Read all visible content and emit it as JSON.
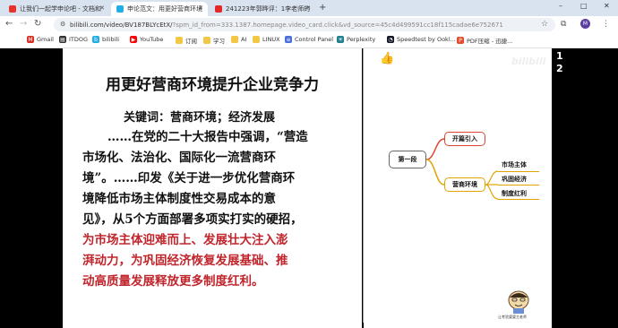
{
  "browser": {
    "tabs": [
      {
        "label": "让我们一起学申论吧 - 文档和",
        "favicon_color": "#e8332a",
        "active": false
      },
      {
        "label": "申论范文：用更好营商环境",
        "favicon_color": "#23ade5",
        "active": true
      },
      {
        "label": "241223年郭晔评：1李老师的",
        "favicon_color": "#e5282a",
        "active": false
      }
    ],
    "new_tab": "+",
    "window_controls": [
      "–",
      "□",
      "✕"
    ],
    "url_main": "bilibili.com/video/BV187BLYcEtX/",
    "url_rest": "?spm_id_from=333.1387.homepage.video_card.click&vd_source=45c4d499591cc18f115cadae6e752671",
    "avatar_letter": "M",
    "bookmarks": [
      {
        "label": "Gmail",
        "icon": "gmail-icon",
        "color": "#d93025",
        "glyph": "M"
      },
      {
        "label": "ITDOG",
        "icon": "itdog-icon",
        "color": "#333333",
        "glyph": "▤"
      },
      {
        "label": "bilibili",
        "icon": "bilibili-icon",
        "color": "#23ade5",
        "glyph": "b"
      },
      {
        "label": "YouTube",
        "icon": "youtube-icon",
        "color": "#ff0000",
        "glyph": "▶"
      },
      {
        "label": "订阅",
        "icon": "folder-icon",
        "color": "#f2c744",
        "glyph": ""
      },
      {
        "label": "学习",
        "icon": "folder-icon",
        "color": "#f2c744",
        "glyph": ""
      },
      {
        "label": "AI",
        "icon": "folder-icon",
        "color": "#f2c744",
        "glyph": ""
      },
      {
        "label": "LINUX",
        "icon": "folder-icon",
        "color": "#f2c744",
        "glyph": ""
      },
      {
        "label": "Control Panel",
        "icon": "control-panel-icon",
        "color": "#4a6fd8",
        "glyph": "≡"
      },
      {
        "label": "Perplexity",
        "icon": "perplexity-icon",
        "color": "#20808d",
        "glyph": "✳"
      },
      {
        "label": "Speedtest by Ookl...",
        "icon": "speedtest-icon",
        "color": "#141526",
        "glyph": "◔"
      },
      {
        "label": "PDF压缩 - 迅捷...",
        "icon": "pdf-icon",
        "color": "#e84a2f",
        "glyph": "P"
      }
    ]
  },
  "slide": {
    "title": "用更好营商环境提升企业竞争力",
    "keywords": "关键词：营商环境；经济发展",
    "body_lines": [
      {
        "text": "……在党的二十大报告中强调，“营造",
        "red": false,
        "indent": true
      },
      {
        "text": "市场化、法治化、国际化一流营商环",
        "red": false,
        "indent": false
      },
      {
        "text": "境”。……印发《关于进一步优化营商环",
        "red": false,
        "indent": false
      },
      {
        "text": "境降低市场主体制度性交易成本的意",
        "red": false,
        "indent": false
      },
      {
        "text": "见》，从5个方面部署多项实打实的硬招，",
        "red": false,
        "indent": false
      },
      {
        "text": "为市场主体迎难而上、发展壮大注入澎",
        "red": true,
        "indent": false
      },
      {
        "text": "湃动力，为巩固经济恢复发展基础、推",
        "red": true,
        "indent": false
      },
      {
        "text": "动高质量发展释放更多制度红利。",
        "red": true,
        "indent": false
      }
    ]
  },
  "mindmap": {
    "root": "第一段",
    "branch_a": "开篇引入",
    "branch_b": "营商环境",
    "leaves": [
      "市场主体",
      "巩固经济",
      "制度红利"
    ],
    "watermark": "bilibili",
    "mascot_caption": "让考验婆婆主老师"
  },
  "side_numbers": [
    "1",
    "2"
  ],
  "colors": {
    "red_text": "#c0252c",
    "branch_a": "#dd4433",
    "branch_b": "#e0a300"
  }
}
